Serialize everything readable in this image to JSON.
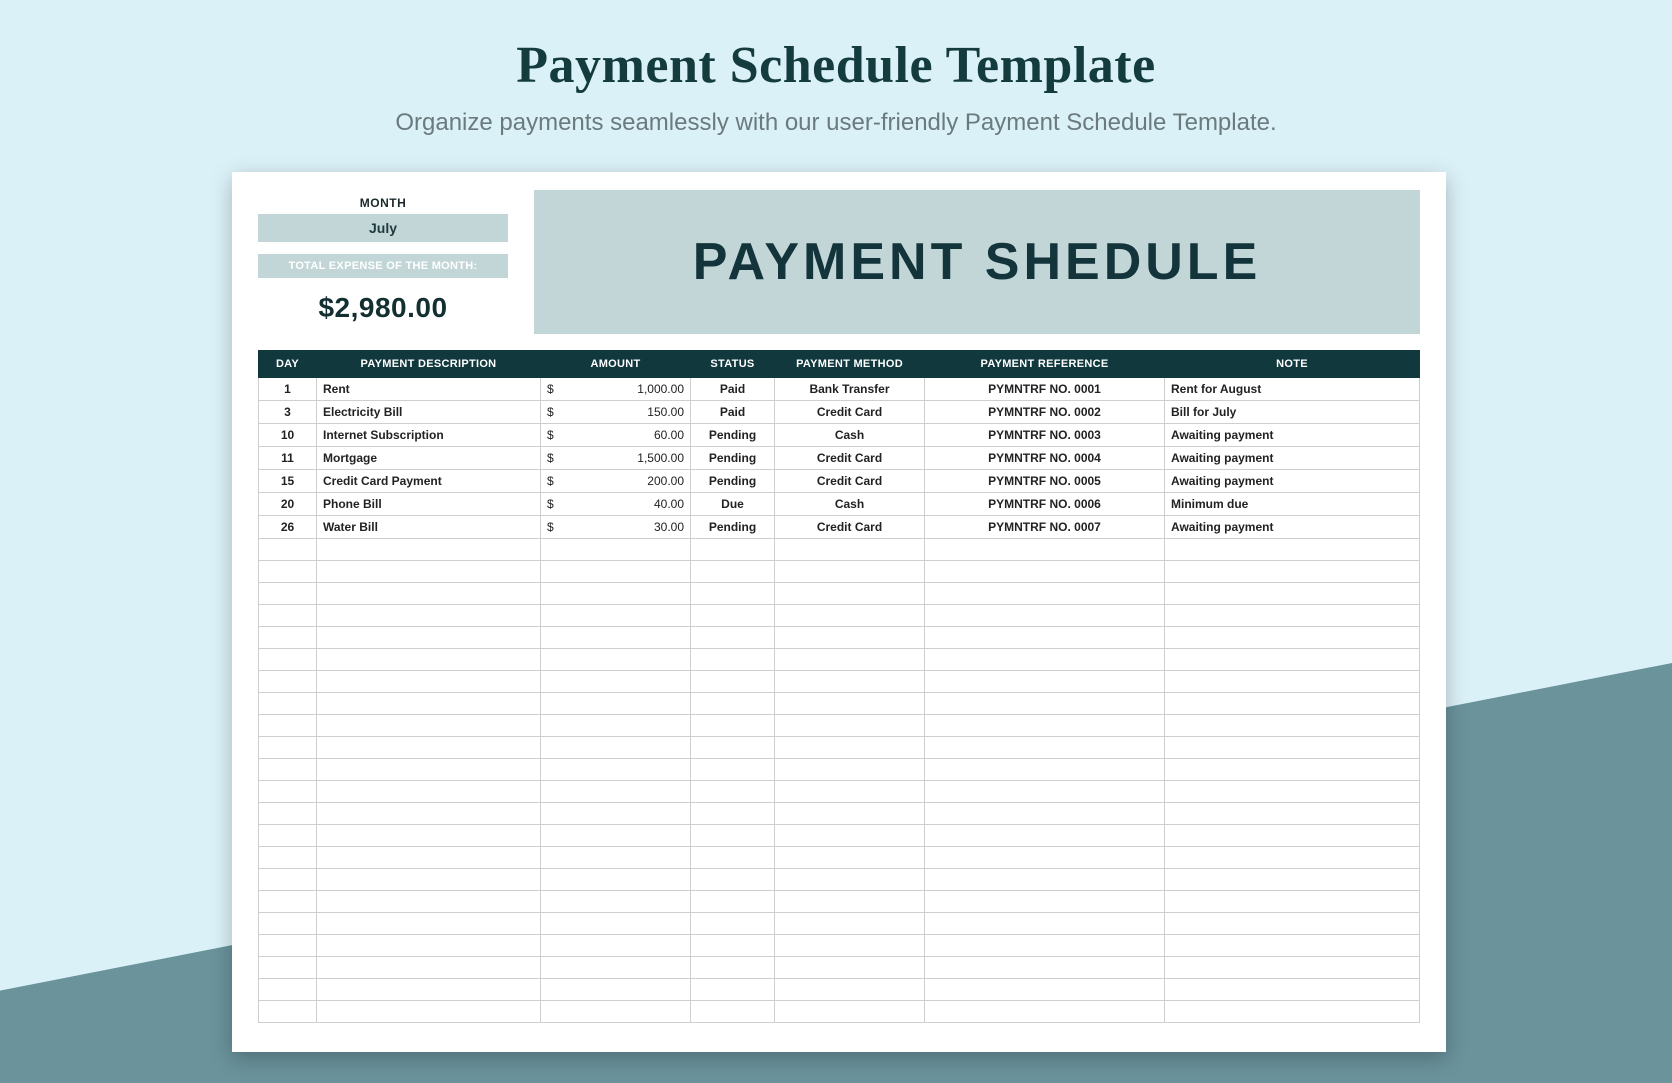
{
  "header": {
    "title": "Payment Schedule Template",
    "subtitle": "Organize payments seamlessly with our user-friendly Payment Schedule Template."
  },
  "summary": {
    "month_label": "MONTH",
    "month_value": "July",
    "total_label": "TOTAL EXPENSE OF THE MONTH:",
    "total_value": "$2,980.00"
  },
  "sheet": {
    "title": "PAYMENT SHEDULE"
  },
  "table": {
    "columns": [
      "DAY",
      "PAYMENT DESCRIPTION",
      "AMOUNT",
      "STATUS",
      "PAYMENT METHOD",
      "PAYMENT REFERENCE",
      "NOTE"
    ],
    "currency_symbol": "$",
    "rows": [
      {
        "day": "1",
        "description": "Rent",
        "amount": "1,000.00",
        "status": "Paid",
        "method": "Bank Transfer",
        "reference": "PYMNTRF NO. 0001",
        "note": "Rent for August"
      },
      {
        "day": "3",
        "description": "Electricity Bill",
        "amount": "150.00",
        "status": "Paid",
        "method": "Credit Card",
        "reference": "PYMNTRF NO. 0002",
        "note": "Bill for July"
      },
      {
        "day": "10",
        "description": "Internet Subscription",
        "amount": "60.00",
        "status": "Pending",
        "method": "Cash",
        "reference": "PYMNTRF NO. 0003",
        "note": "Awaiting payment"
      },
      {
        "day": "11",
        "description": "Mortgage",
        "amount": "1,500.00",
        "status": "Pending",
        "method": "Credit Card",
        "reference": "PYMNTRF NO. 0004",
        "note": "Awaiting payment"
      },
      {
        "day": "15",
        "description": "Credit Card Payment",
        "amount": "200.00",
        "status": "Pending",
        "method": "Credit Card",
        "reference": "PYMNTRF NO. 0005",
        "note": "Awaiting payment"
      },
      {
        "day": "20",
        "description": "Phone Bill",
        "amount": "40.00",
        "status": "Due",
        "method": "Cash",
        "reference": "PYMNTRF NO. 0006",
        "note": "Minimum due"
      },
      {
        "day": "26",
        "description": "Water Bill",
        "amount": "30.00",
        "status": "Pending",
        "method": "Credit Card",
        "reference": "PYMNTRF NO. 0007",
        "note": "Awaiting payment"
      }
    ],
    "empty_rows": 22
  }
}
